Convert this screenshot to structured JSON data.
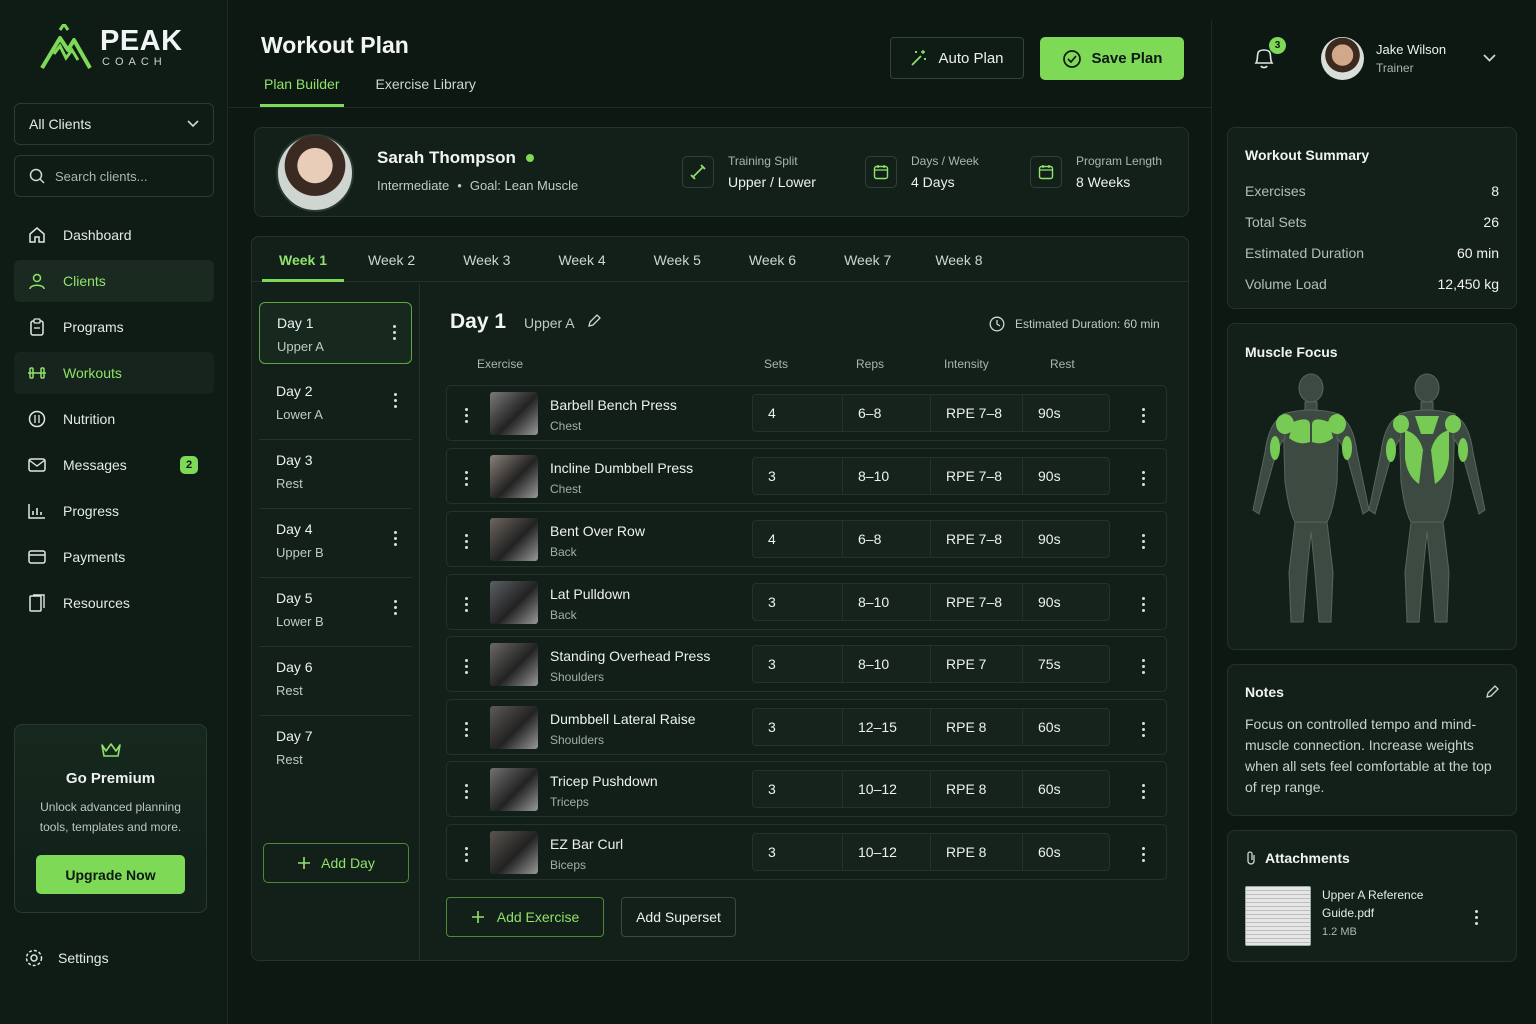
{
  "brand": {
    "name": "PEAK",
    "tagline": "COACH"
  },
  "sidebar": {
    "client_filter": "All Clients",
    "search_placeholder": "Search clients...",
    "items": [
      {
        "label": "Dashboard",
        "icon": "home-icon"
      },
      {
        "label": "Clients",
        "icon": "user-icon"
      },
      {
        "label": "Programs",
        "icon": "clipboard-icon"
      },
      {
        "label": "Workouts",
        "icon": "dumbbell-icon"
      },
      {
        "label": "Nutrition",
        "icon": "nutrition-icon"
      },
      {
        "label": "Messages",
        "icon": "mail-icon",
        "badge": "2"
      },
      {
        "label": "Progress",
        "icon": "chart-icon"
      },
      {
        "label": "Payments",
        "icon": "card-icon"
      },
      {
        "label": "Resources",
        "icon": "book-icon"
      }
    ],
    "premium": {
      "title": "Go Premium",
      "text": "Unlock advanced planning tools, templates and more.",
      "button": "Upgrade Now"
    },
    "settings": "Settings"
  },
  "header": {
    "title": "Workout Plan",
    "tabs": [
      "Plan Builder",
      "Exercise Library"
    ],
    "auto_plan": "Auto Plan",
    "save_plan": "Save Plan",
    "notifications": "3",
    "user": {
      "name": "Jake Wilson",
      "role": "Trainer"
    }
  },
  "client": {
    "name": "Sarah Thompson",
    "level": "Intermediate",
    "goal": "Goal: Lean Muscle",
    "metrics": [
      {
        "label": "Training Split",
        "value": "Upper / Lower"
      },
      {
        "label": "Days / Week",
        "value": "4 Days"
      },
      {
        "label": "Program Length",
        "value": "8 Weeks"
      }
    ]
  },
  "weeks": [
    "Week 1",
    "Week 2",
    "Week 3",
    "Week 4",
    "Week 5",
    "Week 6",
    "Week 7",
    "Week 8"
  ],
  "days": [
    {
      "day": "Day 1",
      "type": "Upper A"
    },
    {
      "day": "Day 2",
      "type": "Lower A"
    },
    {
      "day": "Day 3",
      "type": "Rest"
    },
    {
      "day": "Day 4",
      "type": "Upper B"
    },
    {
      "day": "Day 5",
      "type": "Lower B"
    },
    {
      "day": "Day 6",
      "type": "Rest"
    },
    {
      "day": "Day 7",
      "type": "Rest"
    }
  ],
  "add_day": "Add Day",
  "plan": {
    "day": "Day 1",
    "type": "Upper A",
    "duration": "Estimated Duration: 60 min",
    "columns": [
      "Exercise",
      "Sets",
      "Reps",
      "Intensity",
      "Rest"
    ],
    "exercises": [
      {
        "name": "Barbell Bench Press",
        "muscle": "Chest",
        "sets": "4",
        "reps": "6–8",
        "intensity": "RPE 7–8",
        "rest": "90s"
      },
      {
        "name": "Incline Dumbbell Press",
        "muscle": "Chest",
        "sets": "3",
        "reps": "8–10",
        "intensity": "RPE 7–8",
        "rest": "90s"
      },
      {
        "name": "Bent Over Row",
        "muscle": "Back",
        "sets": "4",
        "reps": "6–8",
        "intensity": "RPE 7–8",
        "rest": "90s"
      },
      {
        "name": "Lat Pulldown",
        "muscle": "Back",
        "sets": "3",
        "reps": "8–10",
        "intensity": "RPE 7–8",
        "rest": "90s"
      },
      {
        "name": "Standing Overhead Press",
        "muscle": "Shoulders",
        "sets": "3",
        "reps": "8–10",
        "intensity": "RPE 7",
        "rest": "75s"
      },
      {
        "name": "Dumbbell Lateral Raise",
        "muscle": "Shoulders",
        "sets": "3",
        "reps": "12–15",
        "intensity": "RPE 8",
        "rest": "60s"
      },
      {
        "name": "Tricep Pushdown",
        "muscle": "Triceps",
        "sets": "3",
        "reps": "10–12",
        "intensity": "RPE 8",
        "rest": "60s"
      },
      {
        "name": "EZ Bar Curl",
        "muscle": "Biceps",
        "sets": "3",
        "reps": "10–12",
        "intensity": "RPE 8",
        "rest": "60s"
      }
    ],
    "add_exercise": "Add Exercise",
    "add_superset": "Add Superset"
  },
  "summary": {
    "title": "Workout Summary",
    "rows": [
      {
        "k": "Exercises",
        "v": "8"
      },
      {
        "k": "Total Sets",
        "v": "26"
      },
      {
        "k": "Estimated Duration",
        "v": "60 min"
      },
      {
        "k": "Volume Load",
        "v": "12,450 kg"
      }
    ]
  },
  "muscle_focus": {
    "title": "Muscle Focus"
  },
  "notes": {
    "title": "Notes",
    "text": "Focus on controlled tempo and mind-muscle connection. Increase weights when all sets feel comfortable at the top of rep range."
  },
  "attachments": {
    "title": "Attachments",
    "file": "Upper A Reference Guide.pdf",
    "size": "1.2 MB"
  },
  "colors": {
    "accent": "#7ed957",
    "background": "#0d1813",
    "panel": "#13201a"
  }
}
